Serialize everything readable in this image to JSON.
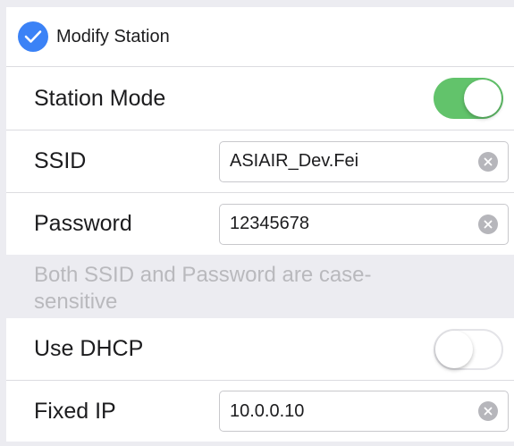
{
  "header": {
    "label": "Modify Station",
    "checked": true,
    "icon": "checkmark-icon",
    "accent_color": "#3b82f6"
  },
  "station_mode": {
    "label": "Station Mode",
    "enabled": true,
    "on_color": "#62c36b"
  },
  "ssid": {
    "label": "SSID",
    "value": "ASIAIR_Dev.Fei"
  },
  "password": {
    "label": "Password",
    "value": "12345678"
  },
  "hint": {
    "text": "Both SSID and Password are case-sensitive"
  },
  "dhcp": {
    "label": "Use DHCP",
    "enabled": false
  },
  "fixed_ip": {
    "label": "Fixed IP",
    "value": "10.0.0.10"
  }
}
